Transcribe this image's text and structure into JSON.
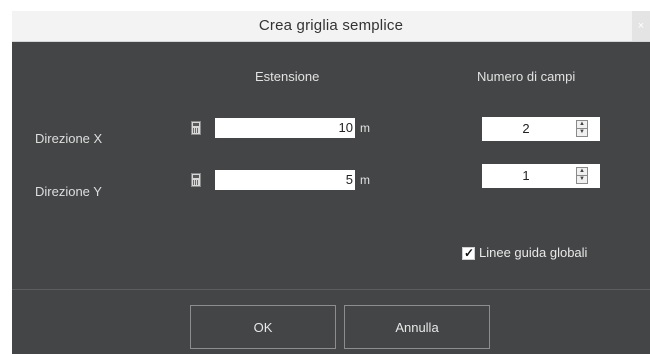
{
  "dialog": {
    "title": "Crea griglia semplice",
    "close_glyph": "×"
  },
  "columns": {
    "extent": "Estensione",
    "fields": "Numero di campi"
  },
  "rows": [
    {
      "label": "Direzione X",
      "extent_value": "10",
      "unit": "m",
      "fields_value": "2"
    },
    {
      "label": "Direzione Y",
      "extent_value": "5",
      "unit": "m",
      "fields_value": "1"
    }
  ],
  "options": {
    "global_guides_label": "Linee guida globali",
    "global_guides_checked": true
  },
  "buttons": {
    "ok": "OK",
    "cancel": "Annulla"
  },
  "icons": {
    "calculator": "calculator-icon",
    "spin_up": "spin-up-icon",
    "spin_down": "spin-down-icon",
    "check": "check-icon"
  },
  "colors": {
    "dialog_bg": "#444546",
    "titlebar_bg": "#f3f3f3"
  }
}
